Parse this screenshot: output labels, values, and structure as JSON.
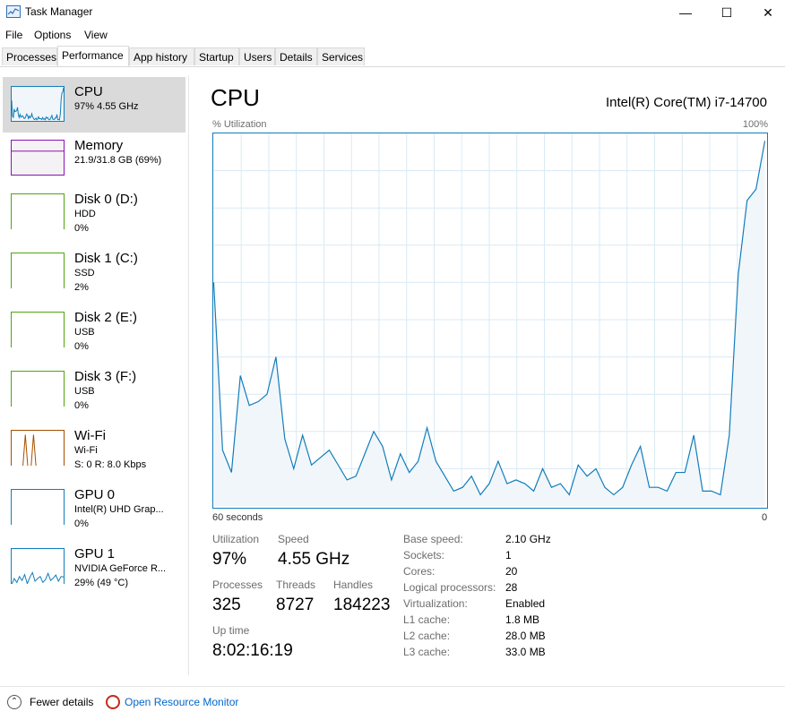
{
  "window": {
    "title": "Task Manager",
    "min_glyph": "—",
    "max_glyph": "☐",
    "close_glyph": "✕"
  },
  "menu": [
    "File",
    "Options",
    "View"
  ],
  "tabs": [
    "Processes",
    "Performance",
    "App history",
    "Startup",
    "Users",
    "Details",
    "Services"
  ],
  "active_tab": "Performance",
  "sidebar": [
    {
      "name": "CPU",
      "line1": "97%  4.55 GHz",
      "line2": "",
      "color": "#117dbb",
      "fill": "#f1f6fa"
    },
    {
      "name": "Memory",
      "line1": "21.9/31.8 GB (69%)",
      "line2": "",
      "color": "#8b12ae",
      "fill": "#f4f2f4"
    },
    {
      "name": "Disk 0 (D:)",
      "line1": "HDD",
      "line2": "0%",
      "color": "#4da60c",
      "fill": "#fff"
    },
    {
      "name": "Disk 1 (C:)",
      "line1": "SSD",
      "line2": "2%",
      "color": "#4da60c",
      "fill": "#fff"
    },
    {
      "name": "Disk 2 (E:)",
      "line1": "USB",
      "line2": "0%",
      "color": "#4da60c",
      "fill": "#fff"
    },
    {
      "name": "Disk 3 (F:)",
      "line1": "USB",
      "line2": "0%",
      "color": "#4da60c",
      "fill": "#fff"
    },
    {
      "name": "Wi-Fi",
      "line1": "Wi-Fi",
      "line2": "S: 0  R: 8.0 Kbps",
      "color": "#a74f01",
      "fill": "#fff"
    },
    {
      "name": "GPU 0",
      "line1": "Intel(R) UHD Grap...",
      "line2": "0%",
      "color": "#117dbb",
      "fill": "#fff"
    },
    {
      "name": "GPU 1",
      "line1": "NVIDIA GeForce R...",
      "line2": "29% (49 °C)",
      "color": "#117dbb",
      "fill": "#fff"
    }
  ],
  "main": {
    "title": "CPU",
    "cpu_name": "Intel(R) Core(TM) i7-14700",
    "util_label": "% Utilization",
    "util_max": "100%",
    "axis_left": "60 seconds",
    "axis_right": "0",
    "stats": {
      "utilization_label": "Utilization",
      "utilization": "97%",
      "speed_label": "Speed",
      "speed": "4.55 GHz",
      "processes_label": "Processes",
      "processes": "325",
      "threads_label": "Threads",
      "threads": "8727",
      "handles_label": "Handles",
      "handles": "184223",
      "uptime_label": "Up time",
      "uptime": "8:02:16:19"
    },
    "specs": [
      {
        "label": "Base speed:",
        "value": "2.10 GHz"
      },
      {
        "label": "Sockets:",
        "value": "1"
      },
      {
        "label": "Cores:",
        "value": "20"
      },
      {
        "label": "Logical processors:",
        "value": "28"
      },
      {
        "label": "Virtualization:",
        "value": "Enabled"
      },
      {
        "label": "L1 cache:",
        "value": "1.8 MB"
      },
      {
        "label": "L2 cache:",
        "value": "28.0 MB"
      },
      {
        "label": "L3 cache:",
        "value": "33.0 MB"
      }
    ]
  },
  "footer": {
    "fewer_details": "Fewer details",
    "open_rm": "Open Resource Monitor"
  },
  "cpu_history": [
    60,
    15,
    9,
    35,
    27,
    28,
    30,
    40,
    18,
    10,
    19,
    11,
    13,
    15,
    11,
    7,
    8,
    14,
    20,
    16,
    7,
    14,
    9,
    12,
    21,
    12,
    8,
    4,
    5,
    8,
    3,
    6,
    12,
    6,
    7,
    6,
    4,
    10,
    5,
    6,
    3,
    11,
    8,
    10,
    5,
    3,
    5,
    11,
    16,
    5,
    5,
    4,
    9,
    9,
    19,
    4,
    4,
    3,
    19,
    62,
    82,
    85,
    98
  ]
}
